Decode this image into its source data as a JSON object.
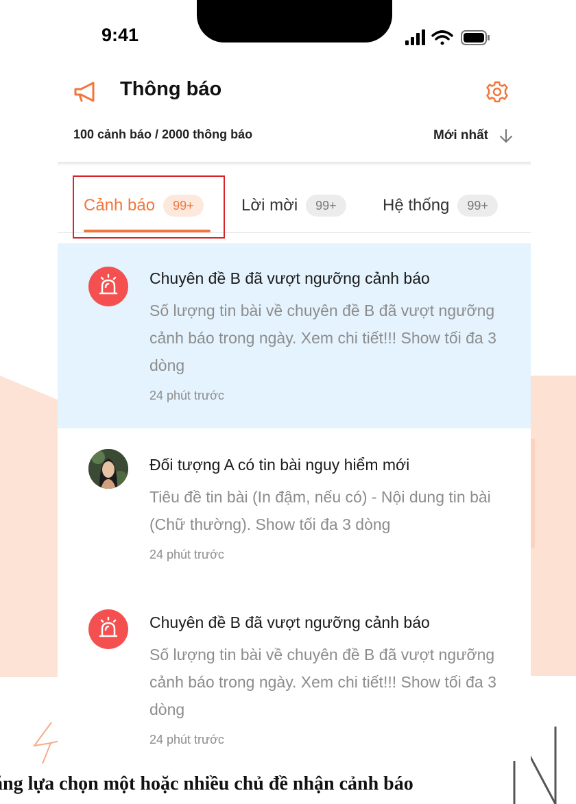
{
  "status_bar": {
    "time": "9:41"
  },
  "header": {
    "title": "Thông báo"
  },
  "summary": {
    "text": "100 cảnh báo  /  2000 thông báo",
    "sort_label": "Mới nhất"
  },
  "tabs": [
    {
      "label": "Cảnh báo",
      "badge": "99+",
      "active": true
    },
    {
      "label": "Lời mời",
      "badge": "99+",
      "active": false
    },
    {
      "label": "Hệ thống",
      "badge": "99+",
      "active": false
    }
  ],
  "notifications": [
    {
      "icon": "alarm-icon",
      "title": "Chuyên đề B đã vượt ngưỡng cảnh báo",
      "body": "Số lượng tin bài về chuyên đề B đã vượt ngưỡng cảnh báo trong ngày. Xem chi tiết!!! Show tối đa 3 dòng",
      "time": "24 phút trước",
      "unread": true
    },
    {
      "icon": "avatar",
      "title": "Đối tượng A có tin bài nguy hiểm mới",
      "body": "Tiêu đề tin bài (In đậm, nếu có) - Nội dung tin bài (Chữ thường). Show tối đa 3 dòng",
      "time": "24 phút trước",
      "unread": false
    },
    {
      "icon": "alarm-icon",
      "title": "Chuyên đề B đã vượt ngưỡng cảnh báo",
      "body": "Số lượng tin bài về chuyên đề B đã vượt ngưỡng cảnh báo trong ngày. Xem chi tiết!!! Show tối đa 3 dòng",
      "time": "24 phút trước",
      "unread": false
    }
  ],
  "caption": "ăng lựa chọn một hoặc nhiều chủ đề nhận cảnh báo",
  "colors": {
    "accent": "#f2763b",
    "alert": "#f45050",
    "unread_bg": "#e4f3fd",
    "highlight_box": "#d9222a"
  }
}
